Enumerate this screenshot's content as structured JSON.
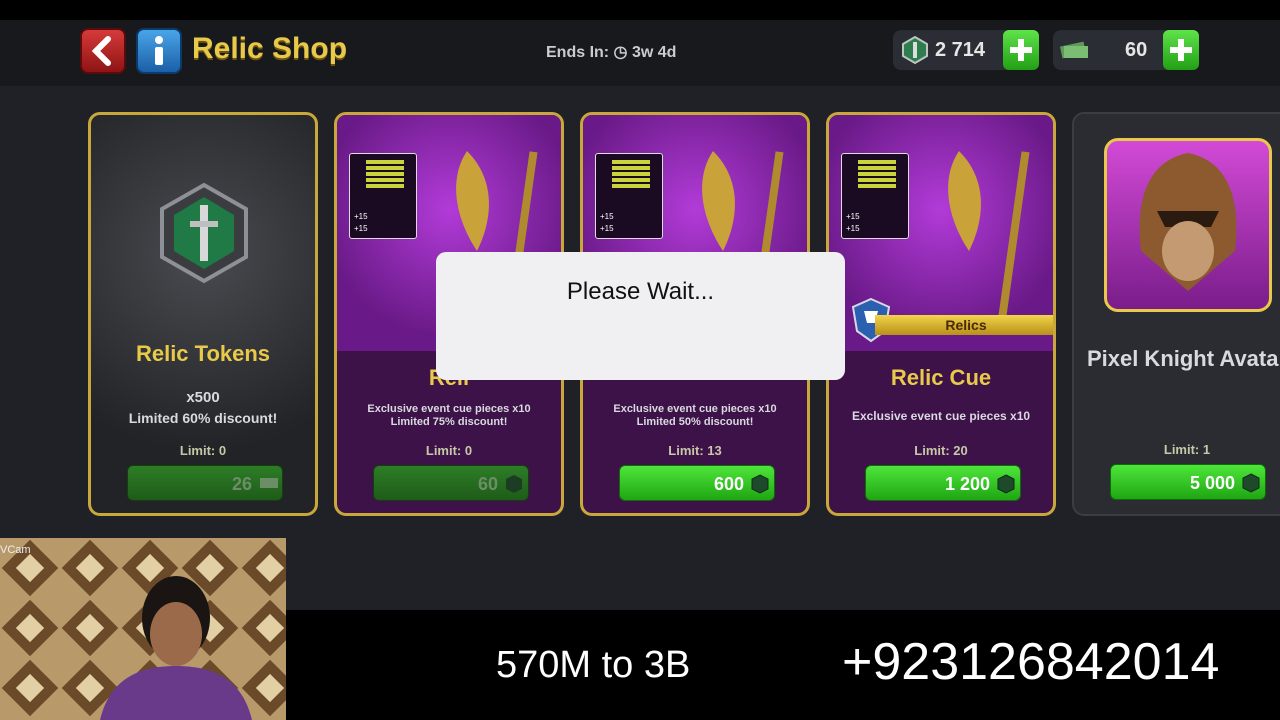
{
  "header": {
    "title": "Relic Shop",
    "ends_in": "Ends In: ◷ 3w 4d",
    "currency": [
      {
        "icon": "relic-token-icon",
        "value": "2 714"
      },
      {
        "icon": "cash-icon",
        "value": "60"
      }
    ]
  },
  "cards": [
    {
      "title": "Relic Tokens",
      "line1": "x500",
      "line2": "Limited 60% discount!",
      "limit": "Limit: 0",
      "price": "26",
      "price_icon": "cash-icon",
      "enabled": false
    },
    {
      "title": "Reli",
      "line1": "Exclusive event cue pieces x10",
      "line2": "Limited 75% discount!",
      "limit": "Limit: 0",
      "price": "60",
      "price_icon": "relic-token-icon",
      "enabled": false
    },
    {
      "title": "",
      "line1": "Exclusive event cue pieces x10",
      "line2": "Limited 50% discount!",
      "limit": "Limit: 13",
      "price": "600",
      "price_icon": "relic-token-icon",
      "enabled": true
    },
    {
      "title": "Relic Cue",
      "ribbon": "Relics",
      "line1": "Exclusive event cue pieces x10",
      "line2": "",
      "limit": "Limit: 20",
      "price": "1 200",
      "price_icon": "relic-token-icon",
      "enabled": true
    },
    {
      "title": "Pixel Knight Avatar",
      "line1": "",
      "line2": "",
      "limit": "Limit: 1",
      "price": "5 000",
      "price_icon": "relic-token-icon",
      "enabled": true
    }
  ],
  "stat_badge": {
    "a": "+15",
    "b": "+15"
  },
  "dialog": {
    "message": "Please Wait..."
  },
  "stream_overlay": {
    "webcam_label": "VCam",
    "caption": "570M to 3B",
    "phone": "+923126842014"
  },
  "colors": {
    "gold": "#e8c94a",
    "green_button": "#3fd12e",
    "purple_card": "#8a2bb0"
  }
}
